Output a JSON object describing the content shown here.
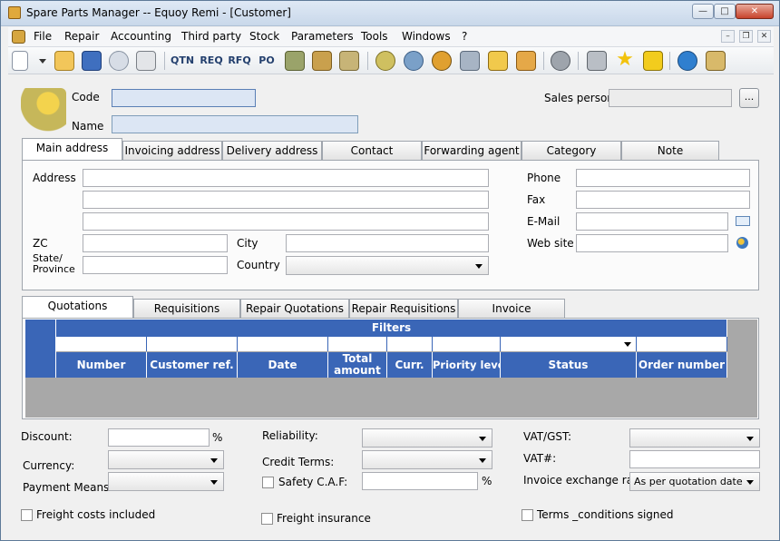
{
  "window": {
    "title": "Spare Parts Manager -- Equoy Remi - [Customer]",
    "controls": {
      "minimize": "—",
      "maximize": "□",
      "close": "✕"
    }
  },
  "menu": {
    "items": [
      "File",
      "Repair",
      "Accounting",
      "Third party",
      "Stock",
      "Parameters",
      "Tools",
      "Windows",
      "?"
    ],
    "mdi": {
      "minimize": "–",
      "restore": "❐",
      "close": "✕"
    }
  },
  "toolbar": {
    "text_buttons": [
      "QTN",
      "REQ",
      "RFQ",
      "PO"
    ]
  },
  "header": {
    "code_label": "Code",
    "name_label": "Name",
    "sales_person_label": "Sales person",
    "browse_label": "..."
  },
  "top_tabs": [
    "Main address",
    "Invoicing address",
    "Delivery address",
    "Contact",
    "Forwarding agent",
    "Category",
    "Note"
  ],
  "address": {
    "address_label": "Address",
    "zc_label": "ZC",
    "city_label": "City",
    "state_label": "State/\nProvince",
    "country_label": "Country",
    "phone_label": "Phone",
    "fax_label": "Fax",
    "email_label": "E-Mail",
    "website_label": "Web site"
  },
  "bottom_tabs": [
    "Quotations",
    "Requisitions",
    "Repair Quotations",
    "Repair Requisitions",
    "Invoice"
  ],
  "grid": {
    "filters_label": "Filters",
    "columns": [
      "Number",
      "Customer ref.",
      "Date",
      "Total amount",
      "Curr.",
      "Priority level",
      "Status",
      "Order number"
    ]
  },
  "footer": {
    "discount_label": "Discount:",
    "percent": "%",
    "currency_label": "Currency:",
    "payment_label": "Payment Means:",
    "reliability_label": "Reliability:",
    "credit_terms_label": "Credit Terms:",
    "safety_label": "Safety C.A.F:",
    "vat_gst_label": "VAT/GST:",
    "vat_no_label": "VAT#:",
    "invoice_rate_label": "Invoice exchange rate:",
    "invoice_rate_value": "As per quotation date",
    "freight_costs_label": "Freight costs included",
    "freight_insurance_label": "Freight insurance",
    "terms_label": "Terms _conditions signed"
  }
}
